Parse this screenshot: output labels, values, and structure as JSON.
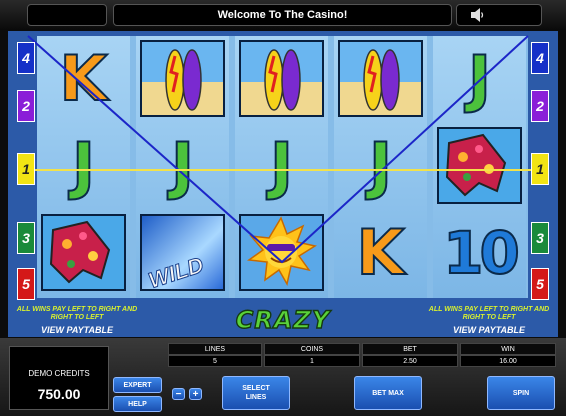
{
  "header": {
    "title": "Welcome To The Casino!"
  },
  "colors": {
    "frame": "#2c5aa8",
    "payline_blue": "#1c26c8",
    "payline_yellow": "#f2e24a",
    "button": "#2a6ad8"
  },
  "reels": [
    [
      "K",
      "J",
      "tropical-shorts"
    ],
    [
      "surfboards",
      "J",
      "wild-wave"
    ],
    [
      "surfboards",
      "J",
      "sun-with-sunglasses"
    ],
    [
      "surfboards",
      "J",
      "K"
    ],
    [
      "J",
      "tropical-shorts",
      "10"
    ]
  ],
  "wild_text": "WILD",
  "line_markers": {
    "left": [
      "4",
      "2",
      "1",
      "3",
      "5"
    ],
    "right": [
      "4",
      "2",
      "1",
      "3",
      "5"
    ]
  },
  "marker_colors": [
    "#1530c8",
    "#8a1ed8",
    "#f2e414",
    "#1a8a3a",
    "#d41818"
  ],
  "bottom": {
    "left_info": "ALL WINS PAY LEFT TO RIGHT AND RIGHT TO LEFT",
    "left_paytable": "VIEW PAYTABLE",
    "game_name": "CRAZY CHAMELEONS",
    "right_info": "ALL WINS PAY LEFT TO RIGHT AND RIGHT TO LEFT",
    "right_paytable": "VIEW PAYTABLE"
  },
  "console": {
    "credits_label": "DEMO CREDITS",
    "credits_value": "750.00",
    "stats": [
      {
        "label": "LINES",
        "value": "5"
      },
      {
        "label": "COINS",
        "value": "1"
      },
      {
        "label": "BET",
        "value": "2.50"
      },
      {
        "label": "WIN",
        "value": "16.00"
      }
    ],
    "expert_label": "EXPERT",
    "help_label": "HELP",
    "minus_label": "−",
    "plus_label": "+",
    "select_lines_label": "SELECT LINES",
    "bet_max_label": "BET MAX",
    "spin_label": "SPIN"
  }
}
